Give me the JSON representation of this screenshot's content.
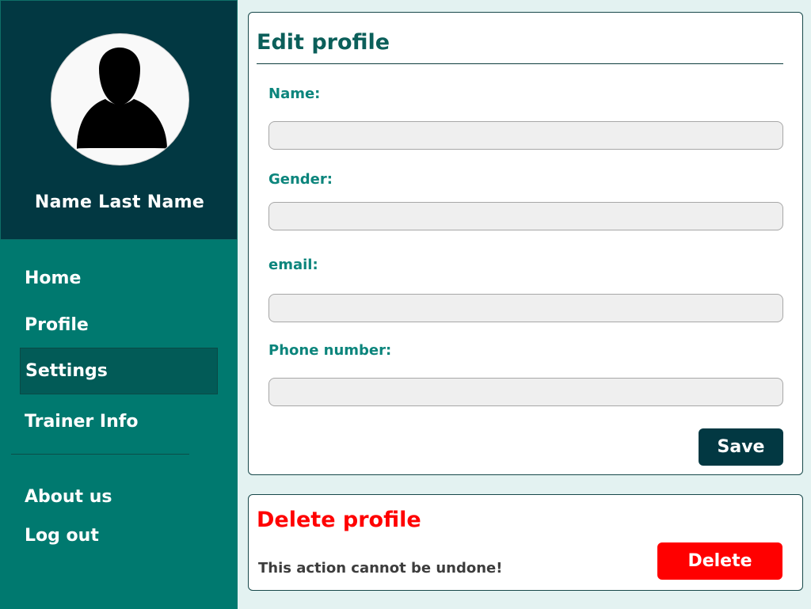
{
  "sidebar": {
    "user_name": "Name Last Name",
    "avatar_icon": "user-silhouette-icon",
    "nav": {
      "home": "Home",
      "profile": "Profile",
      "settings": "Settings",
      "trainer_info": "Trainer Info",
      "about_us": "About us",
      "log_out": "Log out"
    },
    "active_item": "Settings"
  },
  "edit_profile": {
    "title": "Edit profile",
    "fields": {
      "name": {
        "label": "Name:",
        "value": "",
        "placeholder": ""
      },
      "gender": {
        "label": "Gender:",
        "value": "",
        "placeholder": ""
      },
      "email": {
        "label": "email:",
        "value": "",
        "placeholder": ""
      },
      "phone": {
        "label": "Phone number:",
        "value": "",
        "placeholder": ""
      }
    },
    "save_label": "Save"
  },
  "delete_profile": {
    "title": "Delete profile",
    "warning": "This action cannot be undone!",
    "delete_label": "Delete"
  },
  "colors": {
    "sidebar": "#00796f",
    "header": "#023842",
    "accent": "#0c857c",
    "danger": "#ff0000"
  }
}
